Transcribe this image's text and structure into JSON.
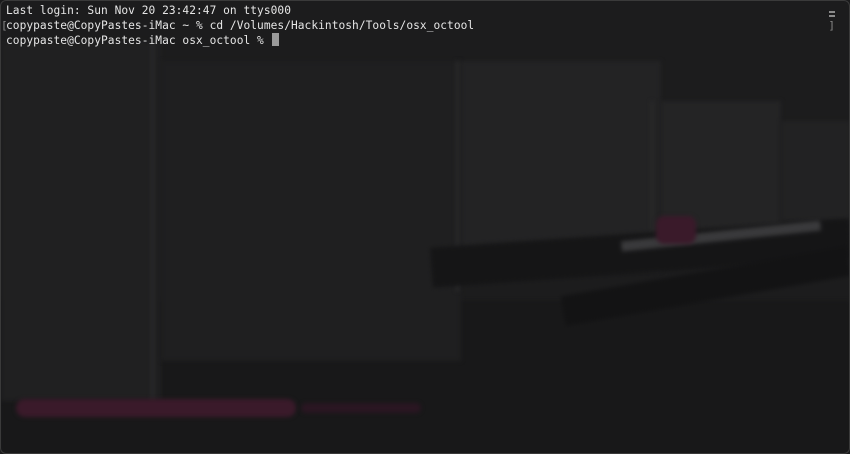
{
  "terminal": {
    "lines": [
      "Last login: Sun Nov 20 23:42:47 on ttys000",
      "copypaste@CopyPastes-iMac ~ % cd /Volumes/Hackintosh/Tools/osx_octool",
      "copypaste@CopyPastes-iMac osx_octool % "
    ],
    "colors": {
      "text": "#e6e6e6",
      "cursor": "#9a9a9a",
      "background": "#1c1c1d"
    }
  },
  "markers": {
    "left_bracket": "[",
    "right_bracket": "]"
  }
}
